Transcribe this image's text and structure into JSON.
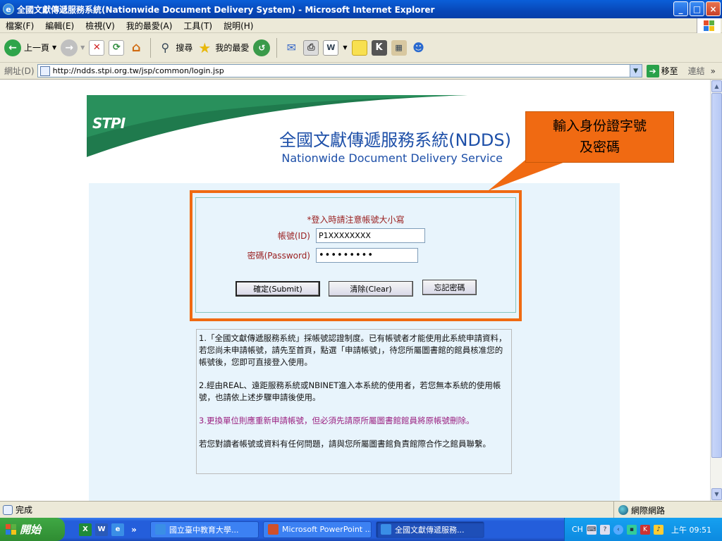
{
  "window": {
    "title": "全國文獻傳遞服務系統(Nationwide Document Delivery System) - Microsoft Internet Explorer",
    "buttons": {
      "minimize": "_",
      "maximize": "□",
      "close": "×"
    }
  },
  "menu": {
    "items": [
      "檔案(F)",
      "編輯(E)",
      "檢視(V)",
      "我的最愛(A)",
      "工具(T)",
      "說明(H)"
    ]
  },
  "toolbar": {
    "back_label": "上一頁",
    "search_label": "搜尋",
    "favorites_label": "我的最愛"
  },
  "address": {
    "label": "網址(D)",
    "url": "http://ndds.stpi.org.tw/jsp/common/login.jsp",
    "go_label": "移至",
    "links_label": "連結"
  },
  "banner": {
    "logo_text": "STPI",
    "title_zh": "全國文獻傳遞服務系統(NDDS)",
    "title_en": "Nationwide Document Delivery Service"
  },
  "callout": {
    "line1": "輸入身份證字號",
    "line2": "及密碼"
  },
  "login": {
    "notice": "*登入時請注意帳號大小寫",
    "id_label": "帳號(ID)",
    "id_value": "P1XXXXXXXX",
    "password_label": "密碼(Password)",
    "password_value": "•••••••••",
    "submit_label": "確定(Submit)",
    "clear_label": "清除(Clear)",
    "forgot_label": "忘記密碼"
  },
  "info": {
    "p1": "1.「全國文獻傳遞服務系統」採帳號認證制度。已有帳號者才能使用此系統申請資料，若您尚未申請帳號，請先至首頁，點選「申請帳號」，待您所屬圖書館的館員核准您的帳號後，您即可直接登入使用。",
    "p2": "2.經由REAL、遠距服務系統或NBINET進入本系統的使用者，若您無本系統的使用帳號，也請依上述步驟申請後使用。",
    "p3": "3.更換單位則應重新申請帳號，但必須先請原所屬圖書館館員將原帳號刪除。",
    "p4": "若您對讀者帳號或資料有任何問題，請與您所屬圖書館負責館際合作之館員聯繫。"
  },
  "status": {
    "text": "完成",
    "zone": "網際網路"
  },
  "taskbar": {
    "start_label": "開始",
    "tasks": [
      "國立臺中教育大學...",
      "Microsoft PowerPoint ...",
      "全國文獻傳遞服務..."
    ],
    "lang": "CH",
    "clock": "上午 09:51"
  },
  "colors": {
    "accent_orange": "#f06a12",
    "label_red": "#9a2020",
    "banner_blue": "#1d4fa8",
    "banner_green": "#1f7a4d",
    "panel_bg": "#e8f4fc"
  }
}
